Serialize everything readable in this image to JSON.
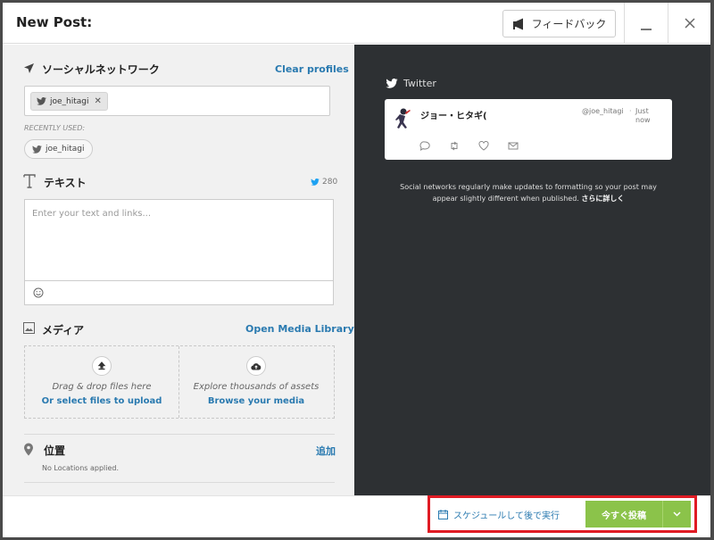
{
  "header": {
    "title": "New Post:",
    "feedback_label": "フィードバック",
    "minimize_symbol": "—",
    "close_symbol": "✕"
  },
  "social": {
    "title": "ソーシャルネットワーク",
    "clear_label": "Clear profiles",
    "selected_profile": "joe_hitagi",
    "remove_symbol": "✕",
    "recently_used_label": "RECENTLY USED:",
    "recent_profile": "joe_hitagi"
  },
  "text": {
    "title": "テキスト",
    "counter": "280",
    "placeholder": "Enter your text and links..."
  },
  "media": {
    "title": "メディア",
    "open_library_label": "Open Media Library",
    "drag_drop_text": "Drag & drop files here",
    "select_files_link": "Or select files to upload",
    "explore_text": "Explore thousands of assets",
    "browse_link": "Browse your media"
  },
  "location": {
    "title": "位置",
    "add_label": "追加",
    "status": "No Locations applied."
  },
  "preview": {
    "network_label": "Twitter",
    "display_name": "ジョー・ヒタギ(",
    "handle": "@joe_hitagi",
    "separator": "·",
    "time": "Just now",
    "notice_text": "Social networks regularly make updates to formatting so your post may appear slightly different when published.",
    "notice_link": "さらに詳しく"
  },
  "footer": {
    "schedule_label": "スケジュールして後で実行",
    "post_now_label": "今すぐ投稿"
  },
  "colors": {
    "accent_blue": "#2a7ab0",
    "post_green": "#8bc34a",
    "preview_bg": "#2d3033",
    "highlight_red": "#e01b24",
    "twitter_blue": "#1da1f2"
  }
}
